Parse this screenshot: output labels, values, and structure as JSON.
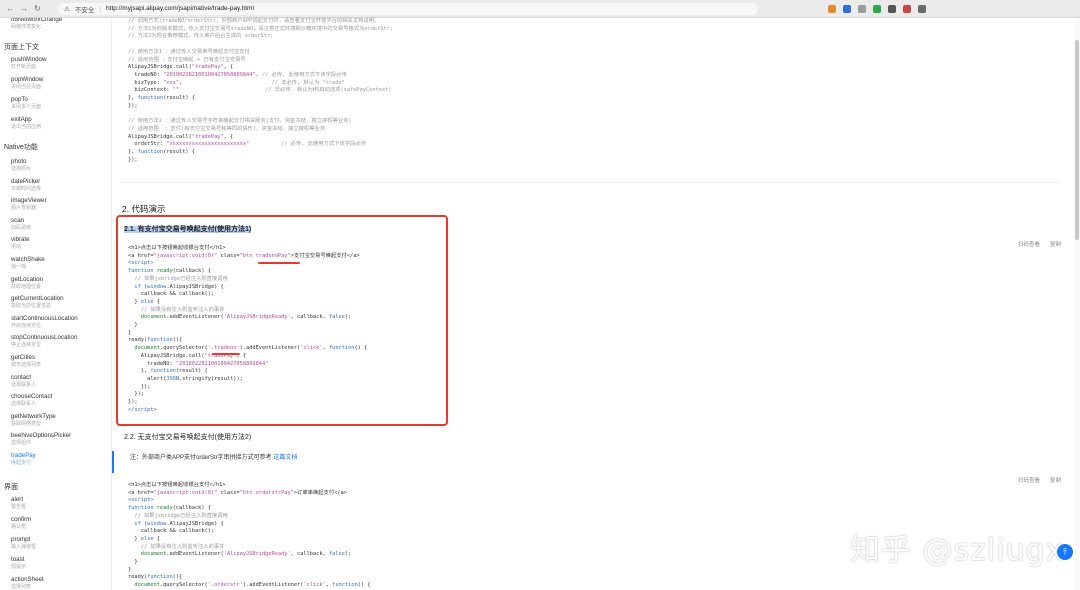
{
  "browser": {
    "insecure_label": "不安全",
    "url": "http://myjsapi.alipay.com/jsapi/native/trade-pay.html"
  },
  "sidebar": {
    "top_items": [
      {
        "title": "h5NetworkChange",
        "sub": "网络环境变化"
      }
    ],
    "sections": [
      {
        "label": "页面上下文"
      },
      {
        "label": "Native功能"
      },
      {
        "label": "界面"
      }
    ],
    "context_items": [
      {
        "title": "pushWindow",
        "sub": "打开新页面"
      },
      {
        "title": "popWindow",
        "sub": "关闭当前页面"
      },
      {
        "title": "popTo",
        "sub": "关闭多个页面"
      },
      {
        "title": "exitApp",
        "sub": "退出当前应用"
      }
    ],
    "native_items": [
      {
        "title": "photo",
        "sub": "选择照片"
      },
      {
        "title": "datePicker",
        "sub": "日期时间选择"
      },
      {
        "title": "imageViewer",
        "sub": "图片查看器"
      },
      {
        "title": "scan",
        "sub": "扫码调用"
      },
      {
        "title": "vibrate",
        "sub": "振动"
      },
      {
        "title": "watchShake",
        "sub": "摇一摇"
      },
      {
        "title": "getLocation",
        "sub": "获取地理位置"
      },
      {
        "title": "getCurrentLocation",
        "sub": "获取当前位置信息"
      },
      {
        "title": "startContinuousLocation",
        "sub": "开启连续定位"
      },
      {
        "title": "stopContinuousLocation",
        "sub": "停止连续定位"
      },
      {
        "title": "getCities",
        "sub": "城市选择列表"
      },
      {
        "title": "contact",
        "sub": "选择联系人"
      },
      {
        "title": "chooseContact",
        "sub": "选择联系人"
      },
      {
        "title": "getNetworkType",
        "sub": "获取网络类型"
      },
      {
        "title": "beehiveOptionsPicker",
        "sub": "选择组件"
      },
      {
        "title": "tradePay",
        "sub": "唤起支付"
      }
    ],
    "ui_items": [
      {
        "title": "alert",
        "sub": "警告框"
      },
      {
        "title": "confirm",
        "sub": "确认框"
      },
      {
        "title": "prompt",
        "sub": "输入弹窗框"
      },
      {
        "title": "toast",
        "sub": "弱提示"
      },
      {
        "title": "actionSheet",
        "sub": "选择列表"
      }
    ]
  },
  "content": {
    "section_title": "2. 代码演示",
    "sub1_title": "2.1. 有支付宝交易号唤起支付(使用方法1)",
    "sub2_title": "2.2. 无支付宝交易号唤起支付(使用方法2)",
    "note_text": "注：外部商户类APP支付orderStr字串拼接方式可参考",
    "note_link": "这篇文档",
    "copy_label": "复制",
    "scan_label": "扫码查看",
    "watermark": "知乎 @szliugx"
  }
}
